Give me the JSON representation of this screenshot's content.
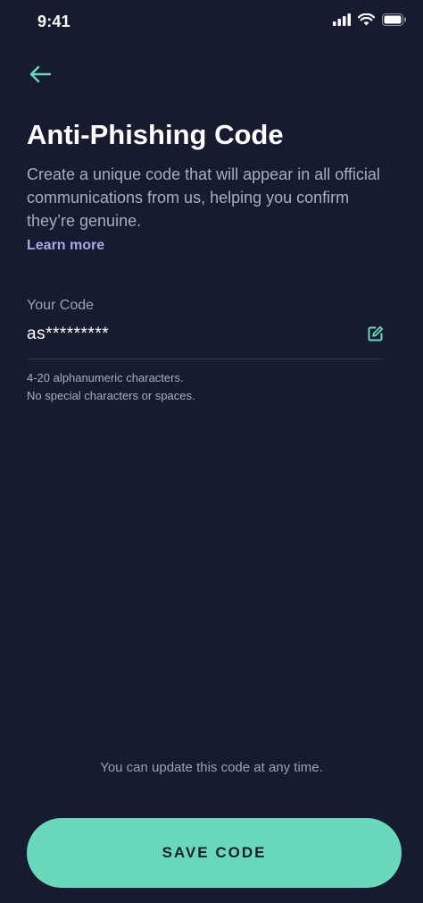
{
  "status_bar": {
    "time": "9:41",
    "icons": [
      "signal-icon",
      "wifi-icon",
      "battery-icon"
    ]
  },
  "header": {
    "back_icon": "arrow-left-icon",
    "title": "Anti-Phishing Code",
    "description": "Create a unique code that will appear in all official communications from us, helping you confirm they’re genuine.",
    "learn_more": "Learn more"
  },
  "code_field": {
    "label": "Your Code",
    "value": "as*********",
    "edit_icon": "edit-icon",
    "helper_lines": [
      "4-20 alphanumeric characters.",
      "No special characters or spaces."
    ]
  },
  "footer": {
    "note": "You can update this code at any time.",
    "save_label": "SAVE CODE"
  },
  "colors": {
    "background": "#161b2f",
    "accent": "#6ad9bb",
    "link": "#a6a8ea",
    "muted_text": "#a7adc3"
  }
}
